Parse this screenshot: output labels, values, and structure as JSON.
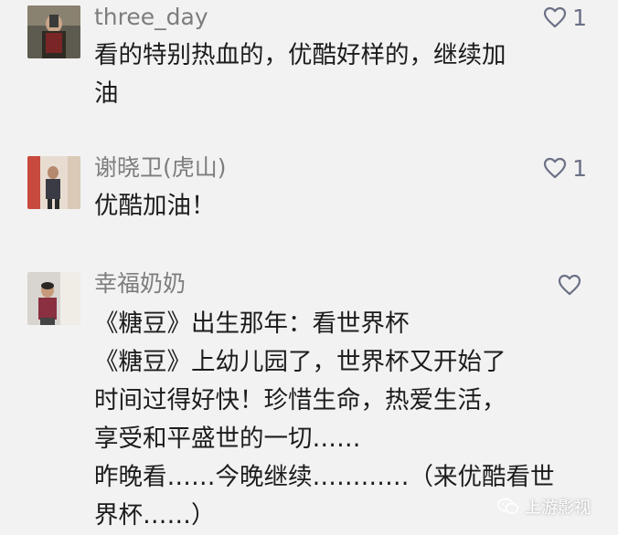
{
  "comments": [
    {
      "username": "three_day",
      "likes": "1",
      "lines": [
        "看的特别热血的，优酷好样的，继续加",
        "油"
      ]
    },
    {
      "username": "谢晓卫(虎山)",
      "likes": "1",
      "lines": [
        "优酷加油！"
      ]
    },
    {
      "username": "幸福奶奶",
      "likes": "",
      "lines": [
        "《糖豆》出生那年：看世界杯",
        "《糖豆》上幼儿园了，世界杯又开始了",
        "时间过得好快！珍惜生命，热爱生活，",
        "享受和平盛世的一切……",
        "昨晚看……今晚继续…………（来优酷看世",
        "界杯……）"
      ]
    }
  ],
  "watermark": {
    "label": "上游影视"
  },
  "colors": {
    "background": "#f2f2f2",
    "username": "#7d7d7d",
    "like_icon": "#6b7086"
  }
}
